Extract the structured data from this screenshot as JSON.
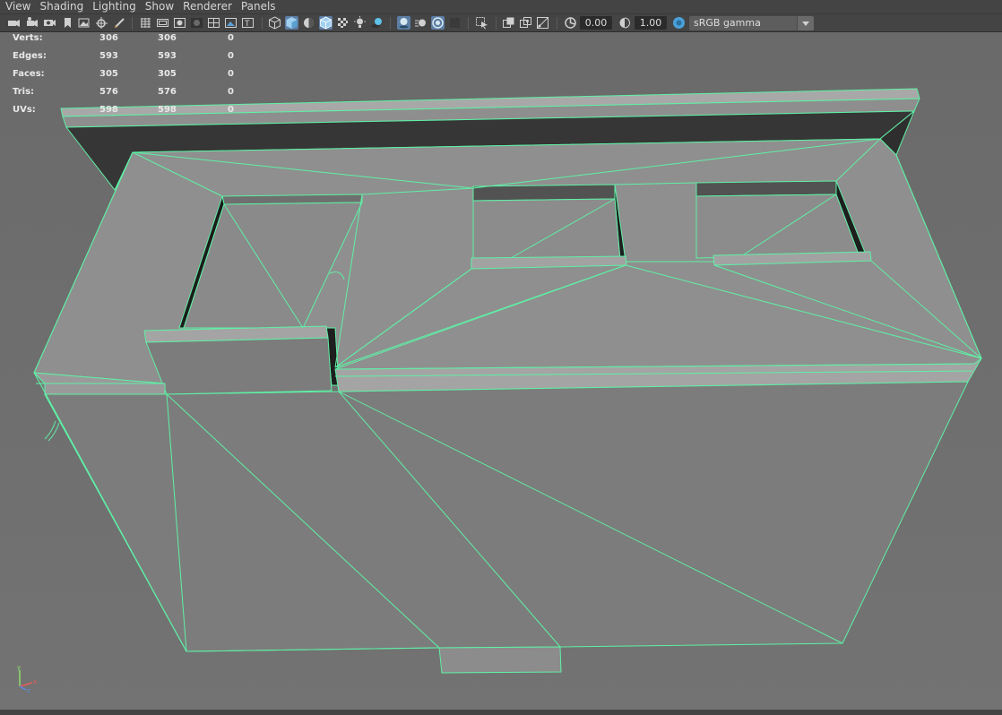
{
  "menubar": {
    "items": [
      "View",
      "Shading",
      "Lighting",
      "Show",
      "Renderer",
      "Panels"
    ]
  },
  "toolbar": {
    "exposure_value": "0.00",
    "gamma_value": "1.00",
    "color_space": "sRGB gamma",
    "icons": [
      "select-camera-icon",
      "camera-attributes-icon",
      "bookmark-icon",
      "image-plane-icon",
      "2d-pan-zoom-icon",
      "grease-pencil-icon",
      "grid-icon",
      "film-gate-icon",
      "resolution-gate-icon",
      "gate-mask-icon",
      "field-chart-icon",
      "safe-action-icon",
      "safe-title-icon",
      "wireframe-icon",
      "smooth-shade-icon",
      "use-default-material-icon",
      "wireframe-on-shaded-icon",
      "textured-icon",
      "use-all-lights-icon",
      "shadows-icon",
      "screen-space-ao-icon",
      "motion-blur-icon",
      "multisample-aa-icon",
      "depth-of-field-icon",
      "isolate-select-icon",
      "xray-icon",
      "xray-joints-icon",
      "xray-components-icon",
      "exposure-icon",
      "gamma-icon",
      "color-management-icon"
    ],
    "colors": {
      "bar": "#444444",
      "active": "#5d7fa6"
    }
  },
  "hud": {
    "rows": [
      {
        "label": "Verts:",
        "v1": "306",
        "v2": "306",
        "v3": "0"
      },
      {
        "label": "Edges:",
        "v1": "593",
        "v2": "593",
        "v3": "0"
      },
      {
        "label": "Faces:",
        "v1": "305",
        "v2": "305",
        "v3": "0"
      },
      {
        "label": "Tris:",
        "v1": "576",
        "v2": "576",
        "v3": "0"
      },
      {
        "label": "UVs:",
        "v1": "598",
        "v2": "598",
        "v3": "0"
      }
    ]
  },
  "viewport": {
    "background": "#6f6f6f",
    "wire_color": "#5ff0a6",
    "axis_labels": {
      "x": "x",
      "y": "y",
      "z": "z"
    }
  }
}
